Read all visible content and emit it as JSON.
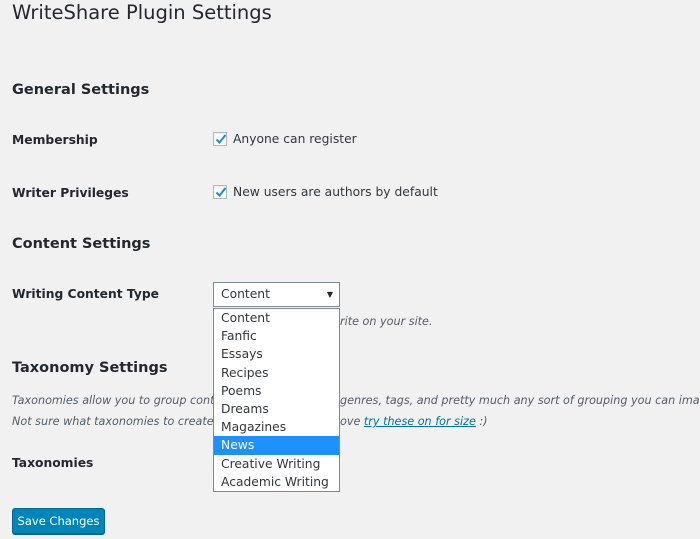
{
  "page": {
    "title": "WriteShare Plugin Settings"
  },
  "general": {
    "title": "General Settings",
    "membership_label": "Membership",
    "membership_checkbox_label": "Anyone can register",
    "membership_checked": true,
    "privileges_label": "Writer Privileges",
    "privileges_checkbox_label": "New users are authors by default",
    "privileges_checked": true
  },
  "content": {
    "title": "Content Settings",
    "type_label": "Writing Content Type",
    "select_value": "Content",
    "desc_visible_fragment": "rite on your site.",
    "options": [
      "Content",
      "Fanfic",
      "Essays",
      "Recipes",
      "Poems",
      "Dreams",
      "Magazines",
      "News",
      "Creative Writing",
      "Academic Writing"
    ],
    "highlighted_option": "News"
  },
  "taxonomy": {
    "title": "Taxonomy Settings",
    "desc_line1_start": "Taxonomies allow you to group content",
    "desc_line1_end": "genres, tags, and pretty much any sort of grouping you can imaging.",
    "desc_line2_start": "Not sure what taxonomies to create? Bo",
    "desc_line2_mid": "ove",
    "desc_link": "try these on for size",
    "desc_line2_end": ":)",
    "label": "Taxonomies"
  },
  "actions": {
    "save_label": "Save Changes"
  },
  "colors": {
    "accent": "#0085ba",
    "highlight": "#1e90ff",
    "link": "#0073aa",
    "background": "#f1f1f1"
  }
}
